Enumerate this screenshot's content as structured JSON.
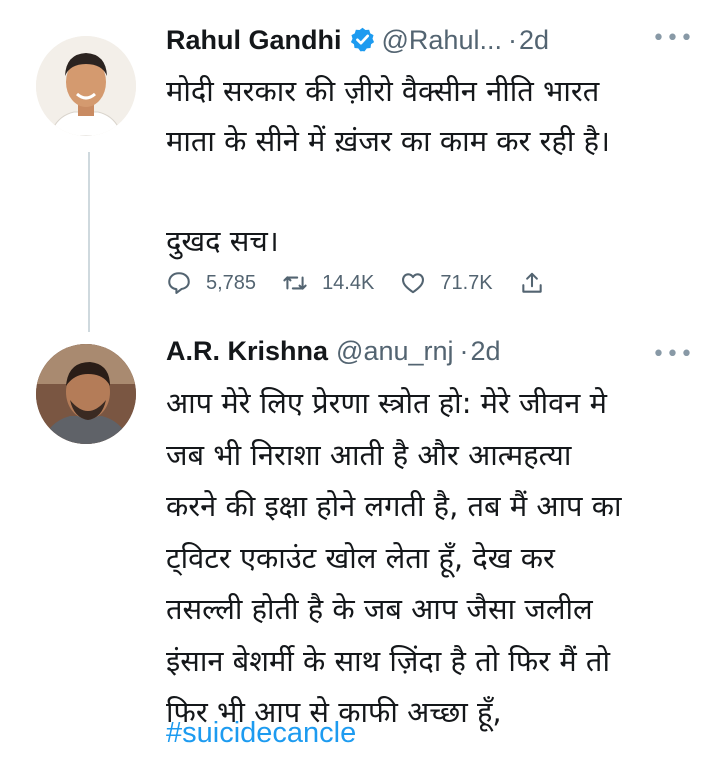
{
  "tweets": [
    {
      "author_name": "Rahul Gandhi",
      "verified": true,
      "handle": "@Rahul...",
      "separator": "·",
      "time": "2d",
      "text": "मोदी सरकार की ज़ीरो वैक्सीन नीति भारत\nमाता के सीने में ख़ंजर का काम कर रही है।\n\nदुखद सच।",
      "actions": {
        "replies": "5,785",
        "retweets": "14.4K",
        "likes": "71.7K"
      }
    },
    {
      "author_name": "A.R. Krishna",
      "verified": false,
      "handle": "@anu_rnj",
      "separator": "·",
      "time": "2d",
      "text": "आप मेरे लिए प्रेरणा स्त्रोत हो: मेरे जीवन मे\nजब भी निराशा आती है और आत्महत्या\nकरने की इक्षा होने लगती है, तब मैं आप का\nट्विटर एकाउंट खोल लेता हूँ, देख कर\nतसल्ली होती है के जब आप जैसा जलील\nइंसान बेशर्मी के साथ ज़िंदा है तो फिर मैं तो\nफिर भी आप से काफी अच्छा हूँ,",
      "hashtag": "#suicidecancle"
    }
  ],
  "icons": {
    "more": "more-horizontal-icon",
    "reply": "reply-icon",
    "retweet": "retweet-icon",
    "like": "heart-icon",
    "share": "share-icon",
    "verified": "verified-badge-icon"
  },
  "colors": {
    "text": "#14171a",
    "secondary": "#536471",
    "accent": "#1d9bf0",
    "thread_line": "#cfd9de"
  }
}
